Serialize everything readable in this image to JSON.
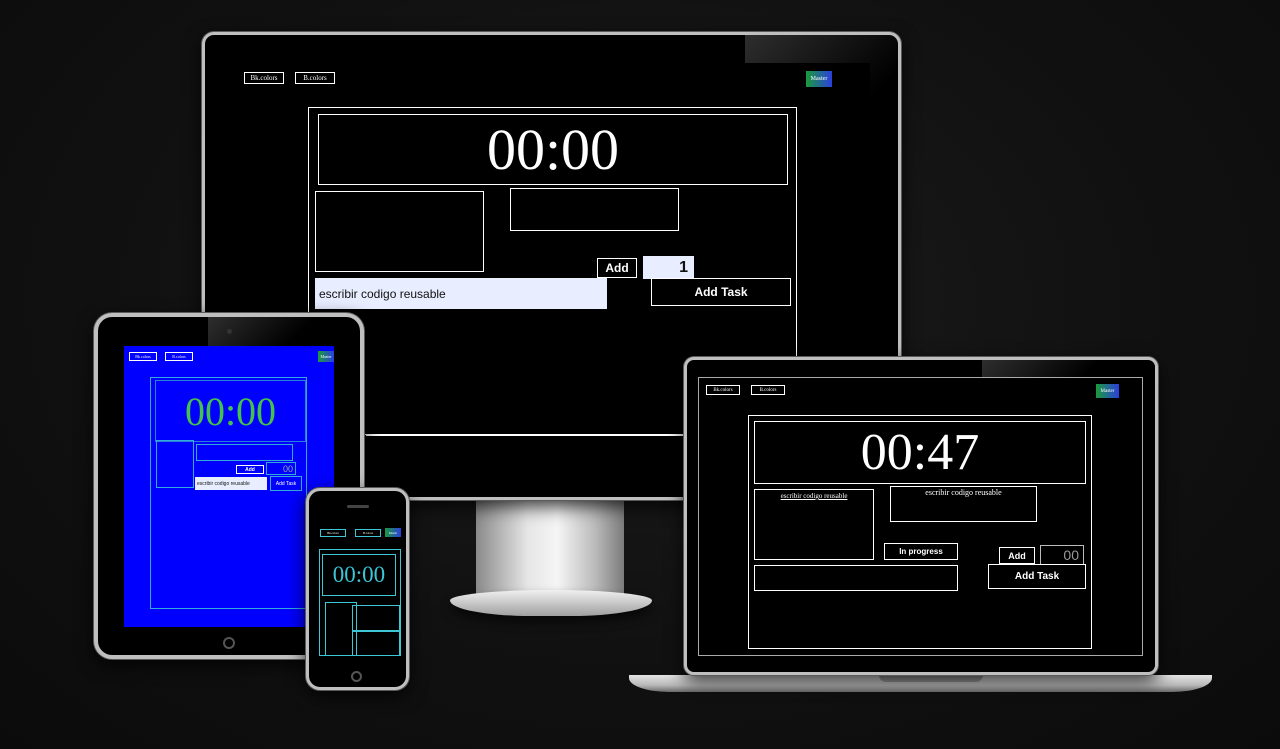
{
  "nav": {
    "bk_colors_label": "Bk.colors",
    "b_colors_label": "B.colors",
    "master_label": "Master"
  },
  "monitor": {
    "timer": "00:00",
    "add_label": "Add",
    "count_value": "1",
    "task_input_value": "escribir codigo reusable",
    "add_task_label": "Add Task"
  },
  "tablet": {
    "timer": "00:00",
    "add_label": "Add",
    "count_value": "00",
    "task_input_value": "escribir codigo reusable",
    "add_task_label": "Add Task"
  },
  "phone": {
    "timer": "00:00"
  },
  "laptop": {
    "timer": "00:47",
    "task_item_1": "escribir codigo reusable",
    "task_item_2": "escribir codigo reusable",
    "status_label": "In progress",
    "add_label": "Add",
    "count_value": "00",
    "add_task_label": "Add Task"
  },
  "colors": {
    "page_bg": "#111111",
    "screen_bg": "#000000",
    "tablet_screen_bg": "#0000ff",
    "tablet_timer": "#45c24a",
    "phone_accent": "#3cc6d6",
    "master_gradient": [
      "#1a9b3a",
      "#2b3fe0"
    ]
  }
}
